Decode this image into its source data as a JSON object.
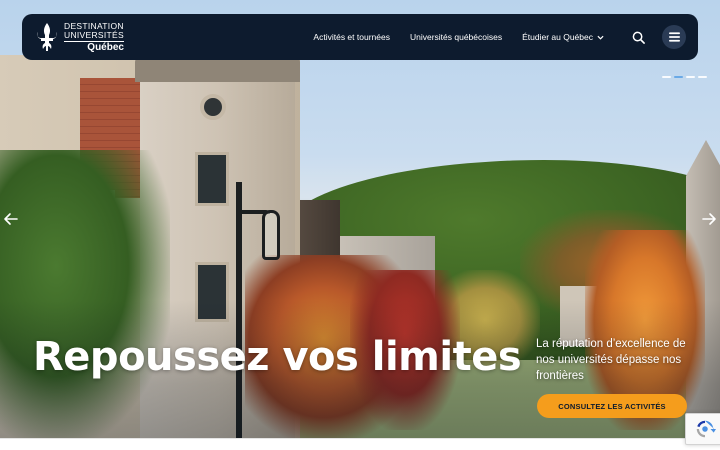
{
  "brand": {
    "line1": "DESTINATION",
    "line2": "UNIVERSITÉS",
    "line3": "Québec"
  },
  "nav": {
    "items": [
      {
        "label": "Activités et tournées"
      },
      {
        "label": "Universités québécoises"
      },
      {
        "label": "Étudier au Québec"
      }
    ],
    "search_icon": "search-icon",
    "menu_icon": "hamburger-menu-icon"
  },
  "slider": {
    "count": 4,
    "active_index": 1
  },
  "hero": {
    "headline": "Repoussez vos limites",
    "subtext": "La réputation d’excellence de nos universités dépasse nos frontières",
    "cta_label": "CONSULTEZ LES ACTIVITÉS"
  },
  "colors": {
    "navbar_bg": "#0d1b2e",
    "cta_bg": "#f59d1c",
    "indicator_active": "#6aa9e6"
  }
}
